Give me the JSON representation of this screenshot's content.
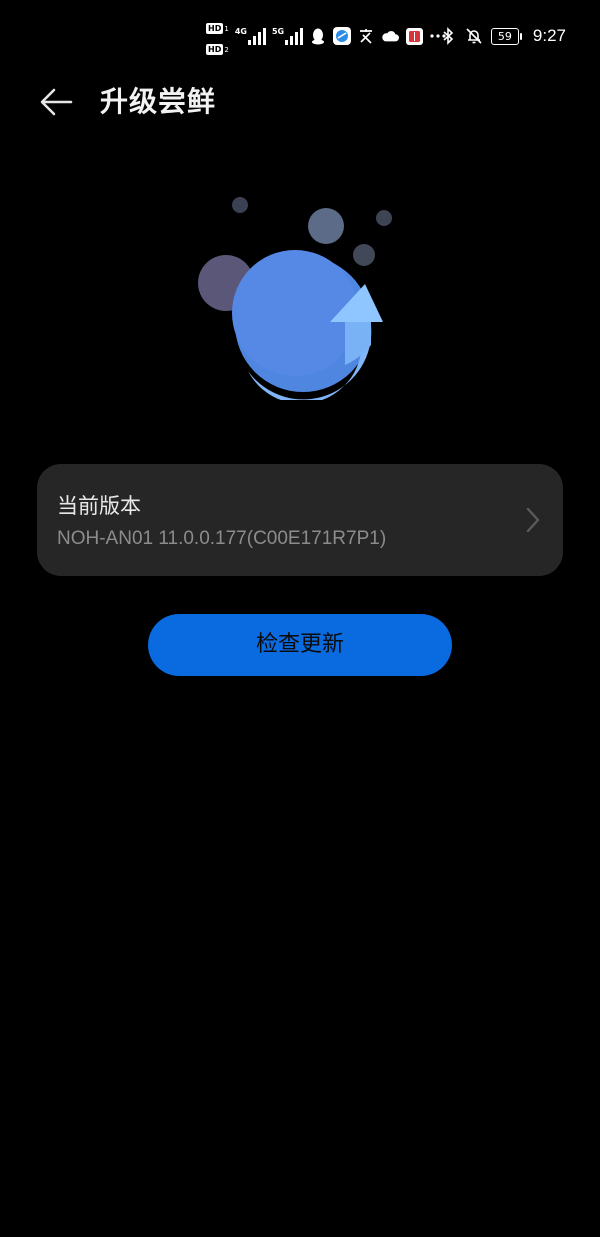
{
  "status_bar": {
    "hd1": "HD",
    "hd1_sub": "1",
    "hd2": "HD",
    "hd2_sub": "2",
    "net1": "4G",
    "net2": "5G",
    "battery": "59",
    "time": "9:27",
    "icons": [
      "qq-icon",
      "browser-icon",
      "translate-icon",
      "cloud-icon",
      "book-icon",
      "more-dots-icon",
      "bluetooth-icon",
      "mute-bell-icon"
    ]
  },
  "header": {
    "title": "升级尝鲜"
  },
  "version_card": {
    "label": "当前版本",
    "value": "NOH-AN01 11.0.0.177(C00E171R7P1)"
  },
  "actions": {
    "check_update": "检查更新"
  },
  "colors": {
    "accent": "#0a6ae0",
    "card_bg": "#262626",
    "page_bg": "#000000"
  }
}
